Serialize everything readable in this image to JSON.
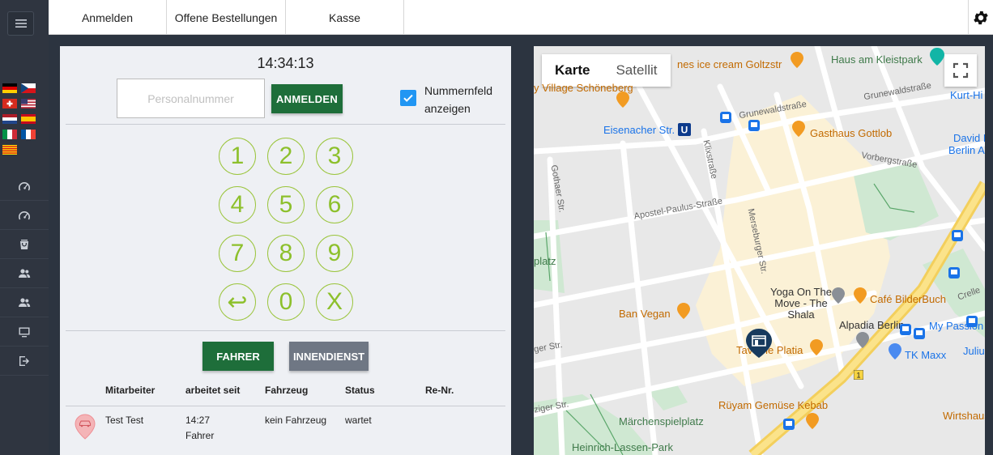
{
  "topbar": {
    "tabs": [
      {
        "label": "Anmelden"
      },
      {
        "label": "Offene Bestellungen"
      },
      {
        "label": "Kasse"
      }
    ]
  },
  "sidebar": {
    "flags": [
      "de-flag",
      "cz-flag",
      "ch-flag",
      "us-flag",
      "nl-flag",
      "es-flag",
      "it-flag",
      "fr-flag",
      "catalonia-flag"
    ],
    "icons": [
      "dashboard-icon",
      "dashboard-icon",
      "bag-icon",
      "users-icon",
      "users-icon",
      "monitor-icon",
      "logout-icon"
    ]
  },
  "login": {
    "clock": "14:34:13",
    "personalnummer_placeholder": "Personalnummer",
    "personalnummer_value": "",
    "anmelden_label": "ANMELDEN",
    "checkbox_label": "Nummernfeld anzeigen",
    "checkbox_checked": true,
    "keys": [
      "1",
      "2",
      "3",
      "4",
      "5",
      "6",
      "7",
      "8",
      "9",
      "↩",
      "0",
      "X"
    ],
    "fahrer_label": "FAHRER",
    "innendienst_label": "INNENDIENST"
  },
  "table": {
    "headers": [
      "Mitarbeiter",
      "arbeitet seit",
      "Fahrzeug",
      "Status",
      "Re-Nr."
    ],
    "rows": [
      {
        "mitarbeiter": "Test Test",
        "seit_time": "14:27",
        "seit_role": "Fahrer",
        "fahrzeug": "kein Fahrzeug",
        "status": "wartet",
        "renr": ""
      }
    ]
  },
  "map": {
    "type_active": "Karte",
    "type_inactive": "Satellit",
    "labels": {
      "ice": "nes ice cream Goltzstr",
      "kleistpark": "Haus am Kleistpark",
      "schoeneberg": "y Village Schöneberg",
      "kurthi": "Kurt-Hi",
      "grunewald1": "Grunewaldstraße",
      "grunewald2": "Grunewaldstraße",
      "eisenacher": "Eisenacher Str.",
      "gottlob": "Gasthaus Gottlob",
      "davidbo": "David Bo",
      "berlinapar": "Berlin Apar",
      "vorberg": "Vorbergstraße",
      "gothaer": "Gothaer Str.",
      "klix": "Klixstraße",
      "apostel": "Apostel-Paulus-Straße",
      "platz": "platz",
      "merseburger": "Merseburger Str.",
      "yoga": "Yoga On The Move - The Shala",
      "bilderbuch": "Café BilderBuch",
      "crelle": "Crelle",
      "banvegan": "Ban Vegan",
      "alpadia": "Alpadia Berlin",
      "passion": "My Passion",
      "juliu": "Juliu",
      "taverne": "Taverne Platia",
      "tkmaxx": "TK Maxx",
      "gerstr": "ger Str.",
      "ruyam": "Rüyam Gemüse Kebab",
      "wirtshaus": "Wirtshaus",
      "ziger": "ziger Str.",
      "maerchen": "Märchenspielplatz",
      "heinrich": "Heinrich-Lassen-Park"
    }
  }
}
